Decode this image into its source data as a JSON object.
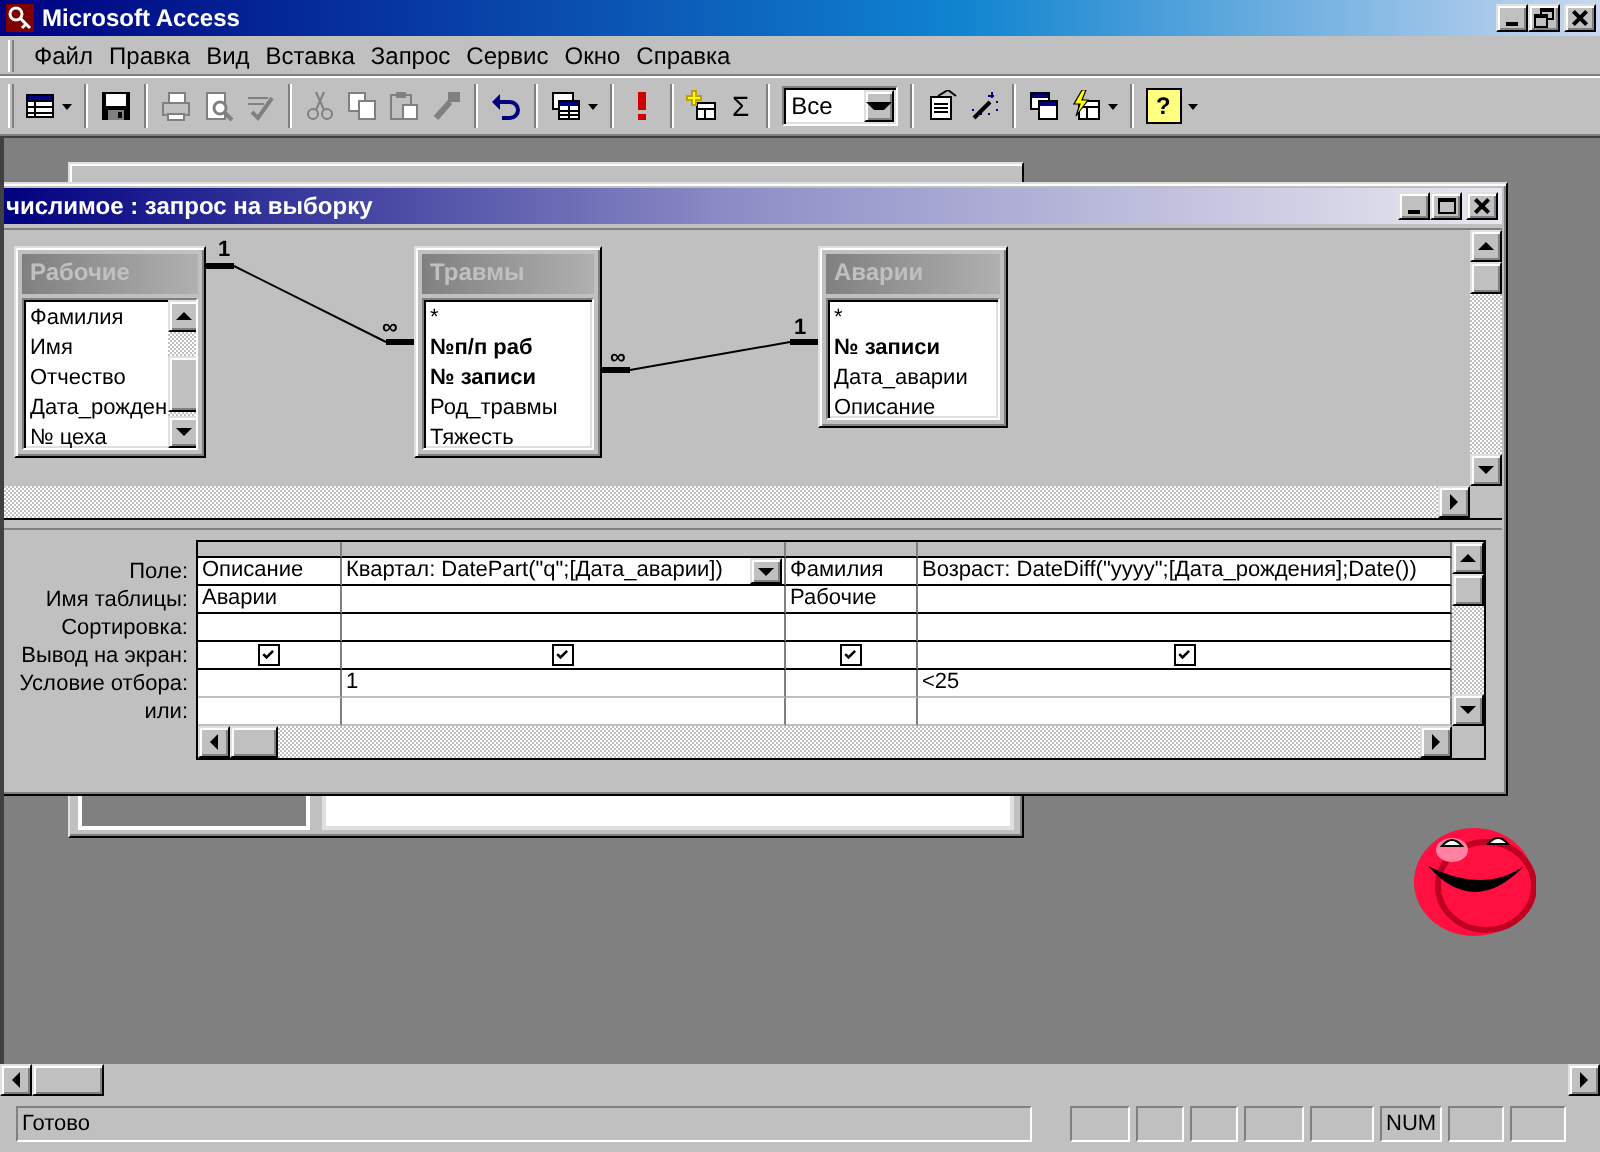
{
  "window": {
    "title": "Microsoft Access"
  },
  "menu": [
    {
      "label": "Файл"
    },
    {
      "label": "Правка"
    },
    {
      "label": "Вид"
    },
    {
      "label": "Вставка"
    },
    {
      "label": "Запрос"
    },
    {
      "label": "Сервис"
    },
    {
      "label": "Окно"
    },
    {
      "label": "Справка"
    }
  ],
  "toolbar": {
    "totals_symbol": "Σ",
    "top_values": "Все",
    "help_symbol": "?"
  },
  "query_window": {
    "title": "числимое : запрос на выборку",
    "tables": [
      {
        "name": "Рабочие",
        "scrollable": true,
        "fields": [
          {
            "name": "Фамилия",
            "key": false
          },
          {
            "name": "Имя",
            "key": false
          },
          {
            "name": "Отчество",
            "key": false
          },
          {
            "name": "Дата_рожден",
            "key": false
          },
          {
            "name": "№ цеха",
            "key": false
          }
        ]
      },
      {
        "name": "Травмы",
        "scrollable": false,
        "fields": [
          {
            "name": "*",
            "key": false
          },
          {
            "name": "№п/п раб",
            "key": true
          },
          {
            "name": "№ записи",
            "key": true
          },
          {
            "name": "Род_травмы",
            "key": false
          },
          {
            "name": "Тяжесть",
            "key": false
          }
        ]
      },
      {
        "name": "Аварии",
        "scrollable": false,
        "fields": [
          {
            "name": "*",
            "key": false
          },
          {
            "name": "№ записи",
            "key": true
          },
          {
            "name": "Дата_аварии",
            "key": false
          },
          {
            "name": "Описание",
            "key": false
          }
        ]
      }
    ],
    "relations": [
      {
        "left_label": "1",
        "right_label": "∞"
      },
      {
        "left_label": "∞",
        "right_label": "1"
      }
    ],
    "grid": {
      "row_labels": [
        "Поле:",
        "Имя таблицы:",
        "Сортировка:",
        "Вывод на экран:",
        "Условие отбора:",
        "или:"
      ],
      "columns": [
        {
          "field": "Описание",
          "table": "Аварии",
          "show": true,
          "selected": false
        },
        {
          "field": "Квартал: DatePart(\"q\";[Дата_аварии])",
          "show": true,
          "criteria": "1",
          "selected": true
        },
        {
          "field": "Фамилия",
          "table": "Рабочие",
          "show": true,
          "selected": false
        },
        {
          "field": "Возраст: DateDiff(\"yyyy\";[Дата_рождения];Date())",
          "show": true,
          "criteria": "<25",
          "selected": false
        }
      ]
    }
  },
  "status_bar": {
    "text": "Готово",
    "num_lock": "NUM"
  }
}
